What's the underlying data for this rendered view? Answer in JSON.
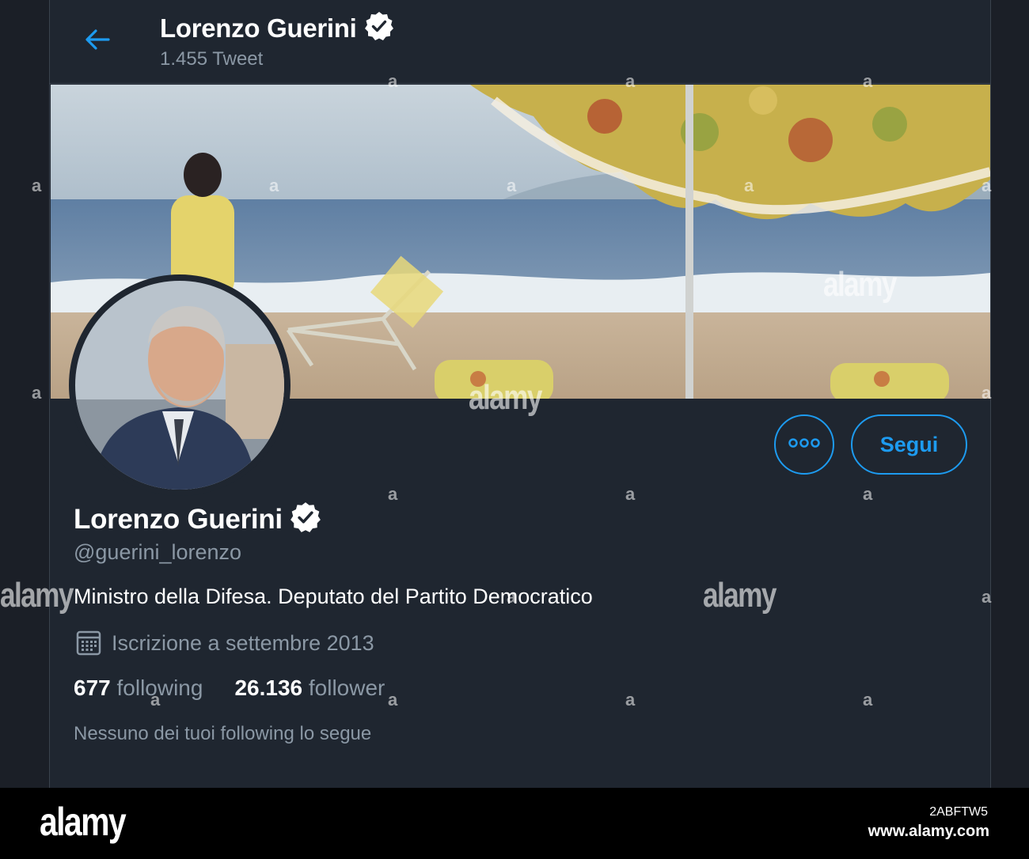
{
  "header": {
    "name": "Lorenzo Guerini",
    "tweet_count": "1.455 Tweet"
  },
  "profile": {
    "name": "Lorenzo Guerini",
    "handle": "@guerini_lorenzo",
    "bio": "Ministro della Difesa. Deputato del Partito Democratico",
    "joined": "Iscrizione a settembre 2013",
    "following_count": "677",
    "following_label": "following",
    "followers_count": "26.136",
    "followers_label": "follower",
    "followed_by_note": "Nessuno dei tuoi following lo segue"
  },
  "actions": {
    "follow_label": "Segui",
    "more_icon": "more-dots-icon"
  },
  "icons": {
    "back": "back-arrow-icon",
    "verified": "verified-badge-icon",
    "calendar": "calendar-icon"
  },
  "colors": {
    "accent": "#1d9bf0",
    "background": "#1f2630",
    "muted_text": "#8b98a5"
  },
  "watermark": {
    "brand": "alamy",
    "image_id": "2ABFTW5",
    "url": "www.alamy.com"
  }
}
